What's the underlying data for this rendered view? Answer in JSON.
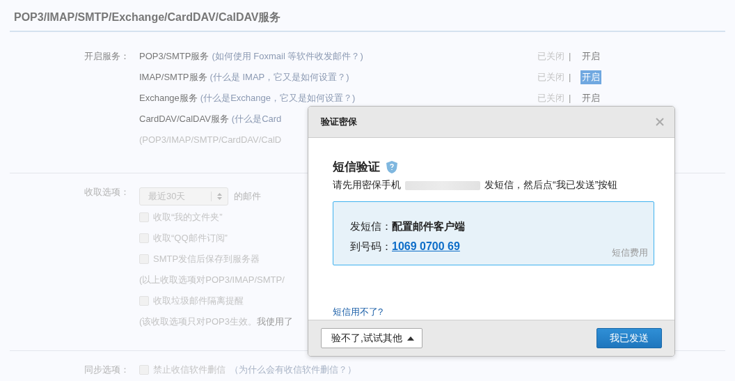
{
  "title": "POP3/IMAP/SMTP/Exchange/CardDAV/CalDAV服务",
  "services": {
    "label": "开启服务：",
    "items": [
      {
        "name": "POP3/SMTP服务",
        "hint": "(如何使用 Foxmail 等软件收发邮件？)",
        "status": "已关闭",
        "separator": "|",
        "action": "开启",
        "highlighted": false
      },
      {
        "name": "IMAP/SMTP服务",
        "hint": "(什么是 IMAP，它又是如何设置？)",
        "status": "已关闭",
        "separator": "|",
        "action": "开启",
        "highlighted": true
      },
      {
        "name": "Exchange服务",
        "hint": "(什么是Exchange，它又是如何设置？)",
        "status": "已关闭",
        "separator": "|",
        "action": "开启",
        "highlighted": false
      },
      {
        "name": "CardDAV/CalDAV服务",
        "hint": "(什么是Card"
      }
    ],
    "note": "(POP3/IMAP/SMTP/CardDAV/CalD"
  },
  "fetch": {
    "label": "收取选项：",
    "select": "最近30天",
    "suffix": "的邮件",
    "options": [
      {
        "kind": "checkbox",
        "label": "收取“我的文件夹”",
        "checked": false
      },
      {
        "kind": "checkbox",
        "label": "收取“QQ邮件订阅”",
        "checked": false
      },
      {
        "kind": "checkbox",
        "label": "SMTP发信后保存到服务器",
        "checked": false
      },
      {
        "kind": "note",
        "text": "(以上收取选项对POP3/IMAP/SMTP/"
      },
      {
        "kind": "checkbox",
        "label": "收取垃圾邮件隔离提醒",
        "checked": false
      },
      {
        "kind": "note",
        "text": "(该收取选项只对POP3生效。",
        "link": "我使用了"
      }
    ]
  },
  "sync": {
    "label": "同步选项：",
    "checkbox": {
      "label": "禁止收信软件删信",
      "checked": false
    },
    "hint": "（为什么会有收信软件删信？）"
  },
  "dialog": {
    "title": "验证密保",
    "heading": "短信验证",
    "instruction_before": "请先用密保手机",
    "instruction_after": "发短信，然后点“我已发送”按钮",
    "sms_lines": [
      {
        "label": "发短信：",
        "value": "配置邮件客户端",
        "kind": "text"
      },
      {
        "label": "到号码：",
        "value": "1069 0700 69",
        "kind": "link"
      }
    ],
    "fee": "短信费用",
    "help_link": "短信用不了?",
    "alt_button": "验不了,试试其他",
    "primary_button": "我已发送"
  }
}
